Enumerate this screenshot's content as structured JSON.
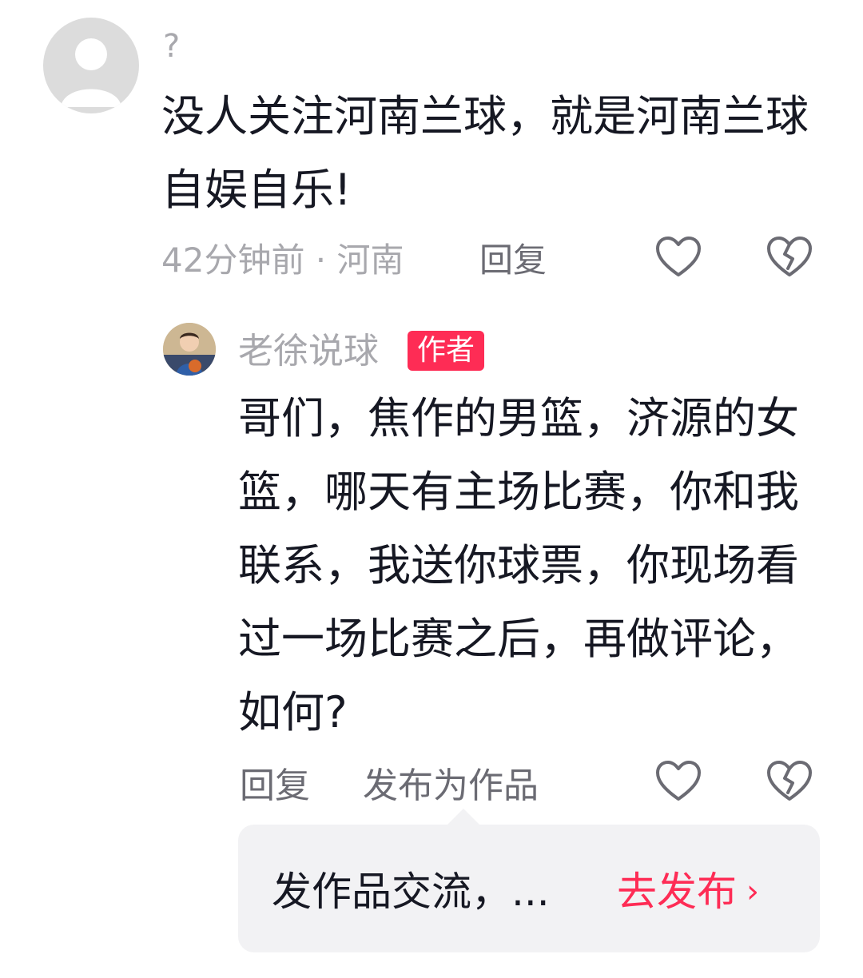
{
  "comment_1": {
    "username": "?",
    "text": "没人关注河南兰球，就是河南兰球自娱自乐!",
    "meta": "42分钟前 · 河南",
    "reply_label": "回复"
  },
  "comment_2": {
    "username": "老徐说球",
    "badge": "作者",
    "text": "哥们，焦作的男篮，济源的女篮，哪天有主场比赛，你和我联系，我送你球票，你现场看过一场比赛之后，再做评论，如何?",
    "reply_label": "回复",
    "publish_label": "发布为作品"
  },
  "tooltip": {
    "text": "发作品交流，...",
    "action_label": "去发布",
    "chevron": "›"
  },
  "colors": {
    "accent": "#fe2c55",
    "muted": "#a8a8ad",
    "text": "#161823",
    "tooltip_bg": "#f2f2f4"
  },
  "icons": {
    "like": "heart-outline-icon",
    "dislike": "broken-heart-icon",
    "default_avatar": "default-user-avatar",
    "author_avatar": "author-cartoon-avatar"
  }
}
